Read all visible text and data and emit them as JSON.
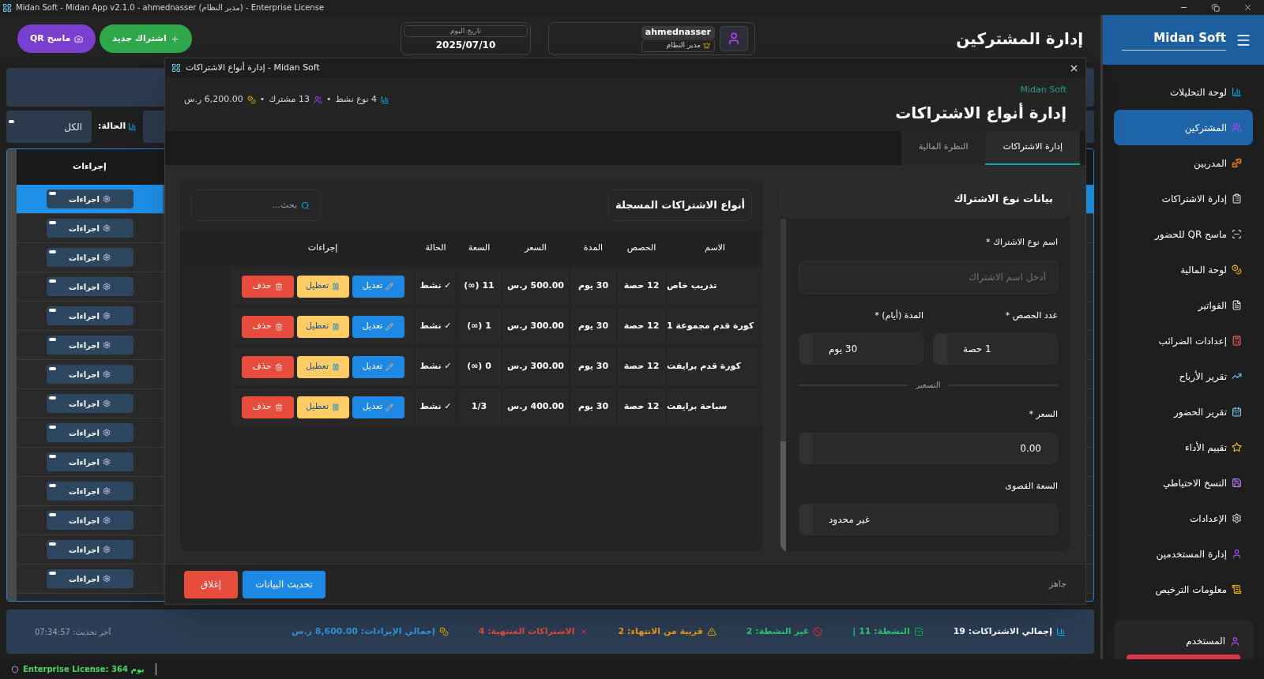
{
  "window": {
    "title": "Midan Soft - Midan App v2.1.0 - ahmednasser (مدير النظام) - Enterprise License"
  },
  "sidebar": {
    "brand": "Midan Soft",
    "items": [
      {
        "label": "لوحة التحليلات",
        "selected": false
      },
      {
        "label": "المشتركين",
        "selected": true
      },
      {
        "label": "المدربين",
        "selected": false
      },
      {
        "label": "إدارة الاشتراكات",
        "selected": false
      },
      {
        "label": "ماسح QR للحضور",
        "selected": false
      },
      {
        "label": "لوحة المالية",
        "selected": false
      },
      {
        "label": "الفواتير",
        "selected": false
      },
      {
        "label": "إعدادات الضرائب",
        "selected": false
      },
      {
        "label": "تقرير الأرباح",
        "selected": false
      },
      {
        "label": "تقرير الحضور",
        "selected": false
      },
      {
        "label": "تقييم الأداء",
        "selected": false
      },
      {
        "label": "النسخ الاحتياطي",
        "selected": false
      },
      {
        "label": "الإعدادات",
        "selected": false
      },
      {
        "label": "إدارة المستخدمين",
        "selected": false
      },
      {
        "label": "معلومات الترخيص",
        "selected": false
      }
    ],
    "user_card": {
      "label": "المستخدم"
    }
  },
  "header": {
    "title": "إدارة المشتركين",
    "user": {
      "name": "ahmednasser",
      "role": "مدير النظام"
    },
    "date": {
      "label": "تاريخ اليوم",
      "value": "2025/07/10"
    },
    "buttons": [
      {
        "kind": "new",
        "label": "اشتراك جديد"
      },
      {
        "kind": "qr",
        "label": "ماسح QR"
      }
    ]
  },
  "filters": {
    "status_label": "الحالة:",
    "status_value": "الكل"
  },
  "subscribers_table": {
    "columns": [
      "إجراءات"
    ],
    "rows": [
      {
        "selected": true,
        "action": "اجراءات"
      },
      {
        "selected": false,
        "action": "اجراءات"
      },
      {
        "selected": false,
        "action": "اجراءات"
      },
      {
        "selected": false,
        "action": "اجراءات"
      },
      {
        "selected": false,
        "action": "اجراءات"
      },
      {
        "selected": false,
        "action": "اجراءات"
      },
      {
        "selected": false,
        "action": "اجراءات"
      },
      {
        "selected": false,
        "action": "اجراءات"
      },
      {
        "selected": false,
        "action": "اجراءات"
      },
      {
        "selected": false,
        "action": "اجراءات"
      },
      {
        "selected": false,
        "action": "اجراءات"
      },
      {
        "selected": false,
        "action": "اجراءات"
      },
      {
        "selected": false,
        "action": "اجراءات"
      },
      {
        "selected": false,
        "action": "اجراءات"
      }
    ]
  },
  "summary_bar": {
    "items": [
      {
        "text": "إجمالي الاشتراكات: 19",
        "color": "#ffffff"
      },
      {
        "text": "النشطة: 11 |",
        "color": "#2ecc71"
      },
      {
        "text": "غير النشطة: 2",
        "color": "#2ecc71"
      },
      {
        "text": "قريبة من الانتهاء: 2",
        "color": "#f39c12"
      },
      {
        "text": "الاشتراكات المنتهية: 4",
        "color": "#e74c3c"
      },
      {
        "text": "إجمالي الإيرادات: 8,600.00 ر.س",
        "color": "#3498db"
      }
    ],
    "last_updated": "آخر تحديث: 07:34:57"
  },
  "license_bar": {
    "text": "Enterprise License: 364 يوم"
  },
  "dialog": {
    "title": "إدارة أنواع الاشتراكات - Midan Soft",
    "brand": "Midan Soft",
    "heading": "إدارة أنواع الاشتراكات",
    "stats": [
      "4 نوع نشط",
      "13 مشترك",
      "6,200.00 ر.س"
    ],
    "stats_separator": "•",
    "tabs": [
      {
        "label": "إدارة الاشتراكات",
        "selected": true
      },
      {
        "label": "النظرة المالية",
        "selected": false
      }
    ],
    "form": {
      "title": "بيانات نوع الاشتراك",
      "name_field": {
        "label": "اسم نوع الاشتراك *",
        "placeholder": "أدخل اسم الاشتراك"
      },
      "sessions_field": {
        "label": "عدد الحصص *",
        "value": "1 حصة"
      },
      "duration_field": {
        "label": "المدة (أيام) *",
        "value": "30 يوم"
      },
      "pricing_divider": "التسعير",
      "price_field": {
        "label": "السعر *",
        "value": "0.00"
      },
      "capacity_field": {
        "label": "السعة القصوى",
        "value": "غير محدود"
      }
    },
    "list": {
      "title": "أنواع الاشتراكات المسجلة",
      "search_placeholder": "بحث...",
      "columns": [
        "الاسم",
        "الحصص",
        "المدة",
        "السعر",
        "السعة",
        "الحالة",
        "إجراءات"
      ],
      "rows": [
        {
          "cells": [
            "تدريب خاص",
            "12 حصة",
            "30 يوم",
            "500.00 ر.س",
            "11 (∞)",
            "✓ نشط"
          ],
          "actions": [
            {
              "kind": "edit",
              "label": "تعديل"
            },
            {
              "kind": "pause",
              "label": "تعطيل"
            },
            {
              "kind": "delete",
              "label": "حذف"
            }
          ]
        },
        {
          "cells": [
            "كورة قدم مجموعة 1",
            "12 حصة",
            "30 يوم",
            "300.00 ر.س",
            "1 (∞)",
            "✓ نشط"
          ],
          "actions": [
            {
              "kind": "edit",
              "label": "تعديل"
            },
            {
              "kind": "pause",
              "label": "تعطيل"
            },
            {
              "kind": "delete",
              "label": "حذف"
            }
          ]
        },
        {
          "cells": [
            "كورة قدم برايفت",
            "12 حصة",
            "30 يوم",
            "300.00 ر.س",
            "0 (∞)",
            "✓ نشط"
          ],
          "actions": [
            {
              "kind": "edit",
              "label": "تعديل"
            },
            {
              "kind": "pause",
              "label": "تعطيل"
            },
            {
              "kind": "delete",
              "label": "حذف"
            }
          ]
        },
        {
          "cells": [
            "سباحة برايفت",
            "12 حصة",
            "30 يوم",
            "400.00 ر.س",
            "1/3",
            "✓ نشط"
          ],
          "actions": [
            {
              "kind": "edit",
              "label": "تعديل"
            },
            {
              "kind": "pause",
              "label": "تعطيل"
            },
            {
              "kind": "delete",
              "label": "حذف"
            }
          ]
        }
      ]
    },
    "status": "جاهز",
    "footer_buttons": [
      {
        "kind": "refresh",
        "label": "تحديث البيانات"
      },
      {
        "kind": "close",
        "label": "إغلاق"
      }
    ]
  }
}
